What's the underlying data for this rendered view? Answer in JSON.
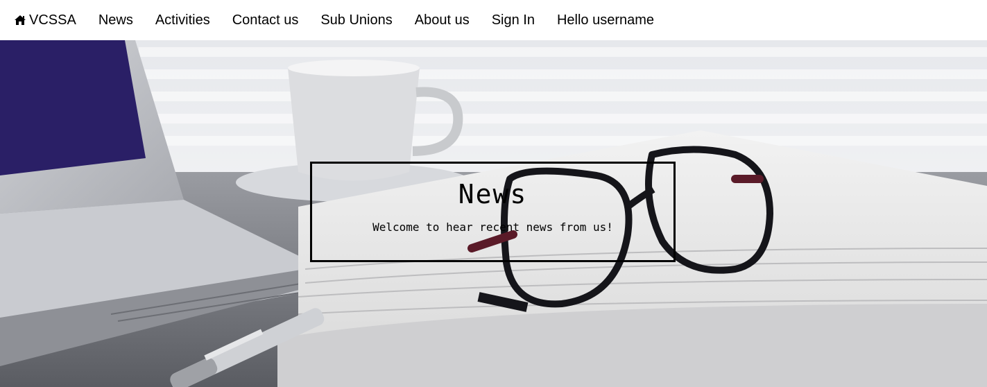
{
  "nav": {
    "brand": {
      "icon": "home-icon",
      "label": "VCSSA"
    },
    "items": [
      {
        "label": "News"
      },
      {
        "label": "Activities"
      },
      {
        "label": "Contact us"
      },
      {
        "label": "Sub Unions"
      },
      {
        "label": "About us"
      },
      {
        "label": "Sign In"
      },
      {
        "label": "Hello username"
      }
    ]
  },
  "hero": {
    "title": "News",
    "subtitle": "Welcome to hear recent news from us!",
    "background_image": "newspaper-glasses-coffee-laptop-photo"
  },
  "colors": {
    "nav_background": "#ffffff",
    "text": "#000000",
    "box_border": "#000000"
  }
}
